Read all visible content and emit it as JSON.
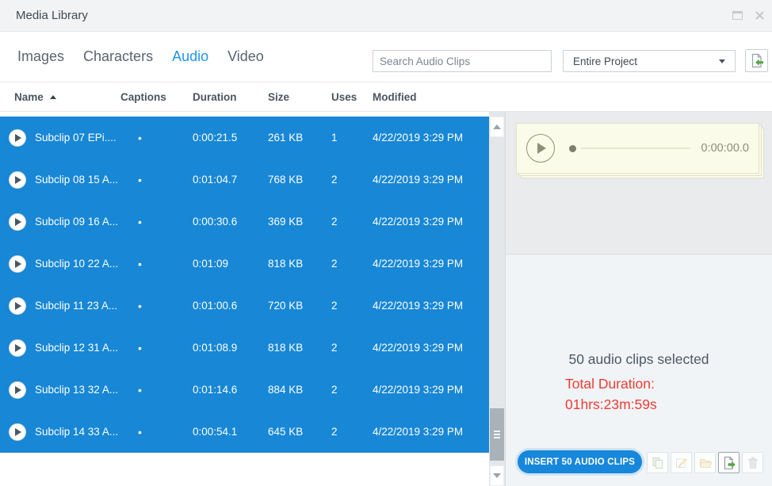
{
  "titlebar": {
    "title": "Media Library"
  },
  "tabs": {
    "items": [
      "Images",
      "Characters",
      "Audio",
      "Video"
    ],
    "active": "Audio"
  },
  "toolbar": {
    "search_placeholder": "Search Audio Clips",
    "scope_value": "Entire Project"
  },
  "table": {
    "columns": {
      "name": "Name",
      "captions": "Captions",
      "duration": "Duration",
      "size": "Size",
      "uses": "Uses",
      "modified": "Modified"
    },
    "sort": {
      "column": "Name",
      "direction": "ascending"
    },
    "rows": [
      {
        "name": "Subclip 07 EPi....",
        "captions": "•",
        "duration": "0:00:21.5",
        "size": "261 KB",
        "uses": "1",
        "modified": "4/22/2019 3:29 PM"
      },
      {
        "name": "Subclip 08 15 A...",
        "captions": "•",
        "duration": "0:01:04.7",
        "size": "768 KB",
        "uses": "2",
        "modified": "4/22/2019 3:29 PM"
      },
      {
        "name": "Subclip 09 16 A...",
        "captions": "•",
        "duration": "0:00:30.6",
        "size": "369 KB",
        "uses": "2",
        "modified": "4/22/2019 3:29 PM"
      },
      {
        "name": "Subclip 10 22 A...",
        "captions": "•",
        "duration": "0:01:09",
        "size": "818 KB",
        "uses": "2",
        "modified": "4/22/2019 3:29 PM"
      },
      {
        "name": "Subclip 11 23 A...",
        "captions": "•",
        "duration": "0:01:00.6",
        "size": "720 KB",
        "uses": "2",
        "modified": "4/22/2019 3:29 PM"
      },
      {
        "name": "Subclip 12 31 A...",
        "captions": "•",
        "duration": "0:01:08.9",
        "size": "818 KB",
        "uses": "2",
        "modified": "4/22/2019 3:29 PM"
      },
      {
        "name": "Subclip 13 32 A...",
        "captions": "•",
        "duration": "0:01:14.6",
        "size": "884 KB",
        "uses": "2",
        "modified": "4/22/2019 3:29 PM"
      },
      {
        "name": "Subclip 14 33 A...",
        "captions": "•",
        "duration": "0:00:54.1",
        "size": "645 KB",
        "uses": "2",
        "modified": "4/22/2019 3:29 PM"
      }
    ]
  },
  "player": {
    "elapsed_time": "0:00:00.0"
  },
  "selection": {
    "summary": "50 audio clips selected",
    "total_duration_label": "Total Duration:",
    "total_duration_value": "01hrs:23m:59s"
  },
  "actions": {
    "insert_label": "INSERT 50 AUDIO CLIPS"
  },
  "colors": {
    "selection_blue": "#1787d6",
    "active_tab_blue": "#2096ea",
    "alert_red": "#ee3b33",
    "insert_button_blue": "#1787db",
    "player_card_bg": "#fbfbe9"
  }
}
